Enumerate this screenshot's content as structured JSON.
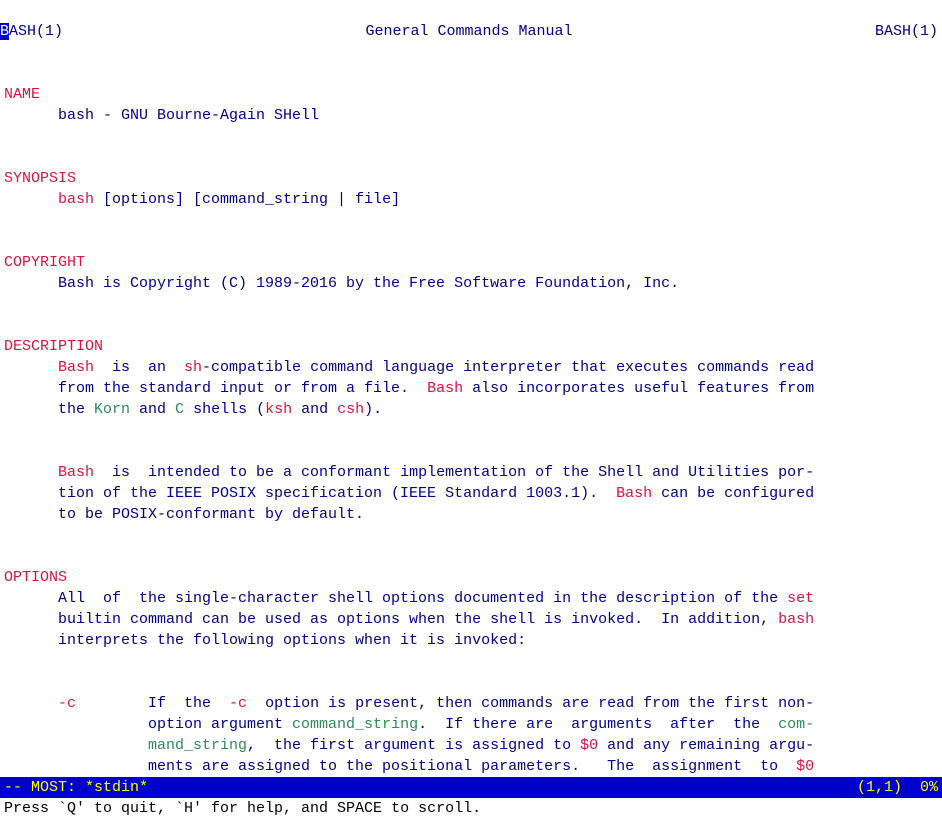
{
  "header": {
    "left": "ASH(1)",
    "left_cursor": "B",
    "center": "General Commands Manual",
    "right": "BASH(1)"
  },
  "sections": {
    "name_hdr": "NAME",
    "name_body": "bash - GNU Bourne-Again SHell",
    "synopsis_hdr": "SYNOPSIS",
    "synopsis_cmd": "bash",
    "synopsis_args": " [options] [command_string | file]",
    "copyright_hdr": "COPYRIGHT",
    "copyright_body": "Bash is Copyright (C) 1989-2016 by the Free Software Foundation, Inc.",
    "description_hdr": "DESCRIPTION",
    "desc_p1_a": "Bash",
    "desc_p1_b": "  is  an  ",
    "desc_p1_c": "sh",
    "desc_p1_d": "-compatible command language interpreter that executes commands read",
    "desc_p1_e": "from the standard input or from a file.  ",
    "desc_p1_f": "Bash",
    "desc_p1_g": " also incorporates useful features from",
    "desc_p1_h": "the ",
    "desc_p1_korn": "Korn",
    "desc_p1_i": " and ",
    "desc_p1_cshell": "C",
    "desc_p1_j": " shells (",
    "desc_p1_ksh": "ksh",
    "desc_p1_k": " and ",
    "desc_p1_csh": "csh",
    "desc_p1_l": ").",
    "desc_p2_a": "Bash",
    "desc_p2_b": "  is  intended to be a conformant implementation of the Shell and Utilities por-",
    "desc_p2_c": "tion of the IEEE POSIX specification (IEEE Standard 1003.1).  ",
    "desc_p2_d": "Bash",
    "desc_p2_e": " can be configured",
    "desc_p2_f": "to be POSIX-conformant by default.",
    "options_hdr": "OPTIONS",
    "opt_p1_a": "All  of  the single-character shell options documented in the description of the ",
    "opt_p1_set": "set",
    "opt_p1_b": "builtin command can be used as options when the shell is invoked.  In addition, ",
    "opt_p1_bash": "bash",
    "opt_p1_c": "interprets the following options when it is invoked:",
    "opt_c_flag": "-c",
    "opt_c_l1a": "        If  the  ",
    "opt_c_l1b": "-c",
    "opt_c_l1c": "  option is present, then commands are read from the first non-",
    "opt_c_l2a": "          option argument ",
    "opt_c_l2b": "command_string",
    "opt_c_l2c": ".  If there are  arguments  after  the  ",
    "opt_c_l2d": "com-",
    "opt_c_l3a": "          ",
    "opt_c_l3b": "mand_string",
    "opt_c_l3c": ",  the first argument is assigned to ",
    "opt_c_l3d": "$0",
    "opt_c_l3e": " and any remaining argu-",
    "opt_c_l4a": "          ments are assigned to the positional parameters.   The  assignment  to  ",
    "opt_c_l4b": "$0"
  },
  "status": {
    "left": "-- MOST: *stdin*",
    "right": "(1,1)  0%"
  },
  "footer": "Press `Q' to quit, `H' for help, and SPACE to scroll."
}
